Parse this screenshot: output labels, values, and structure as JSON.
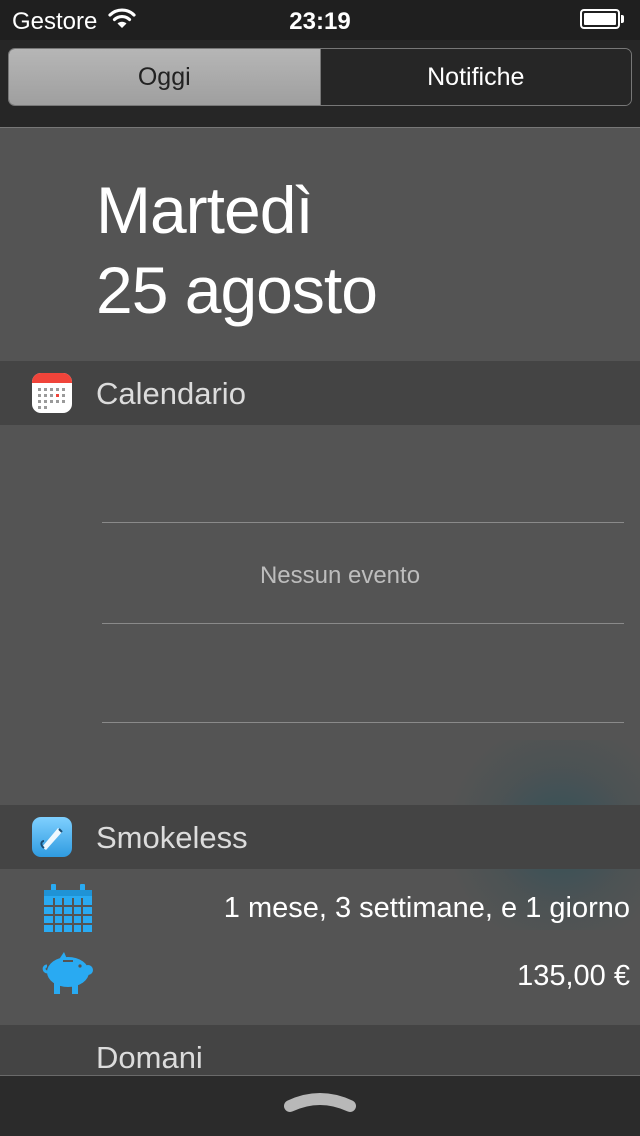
{
  "status_bar": {
    "carrier": "Gestore",
    "time": "23:19"
  },
  "segmented": {
    "tabs": [
      {
        "label": "Oggi",
        "selected": true
      },
      {
        "label": "Notifiche",
        "selected": false
      }
    ]
  },
  "date": {
    "weekday": "Martedì",
    "day_month": "25 agosto"
  },
  "calendar": {
    "title": "Calendario",
    "no_events": "Nessun evento",
    "icon": "calendar-app-icon"
  },
  "smokeless": {
    "title": "Smokeless",
    "icon": "smokeless-app-icon",
    "duration": "1 mese, 3 settimane, e 1 giorno",
    "savings": "135,00 €",
    "accent": "#29aaf2"
  },
  "tomorrow": {
    "title": "Domani"
  },
  "colors": {
    "background": "#545454",
    "header": "#444444",
    "status_bar": "#1f1f1f"
  }
}
